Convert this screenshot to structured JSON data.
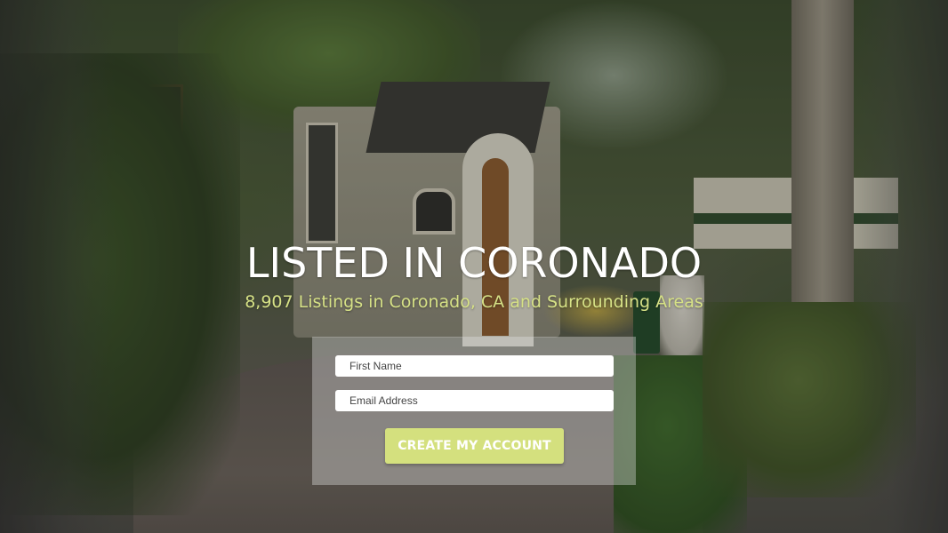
{
  "hero": {
    "title": "LISTED IN CORONADO",
    "subtitle": "8,907 Listings in Coronado, CA and Surrounding Areas"
  },
  "signup_form": {
    "first_name": {
      "value": "",
      "placeholder": "First Name"
    },
    "email": {
      "value": "",
      "placeholder": "Email Address"
    },
    "submit_label": "CREATE MY ACCOUNT"
  },
  "colors": {
    "title": "#ffffff",
    "subtitle": "#d6e186",
    "button_background": "#d4e07e",
    "button_text": "#ffffff",
    "panel_background": "rgba(225,225,225,0.38)"
  }
}
